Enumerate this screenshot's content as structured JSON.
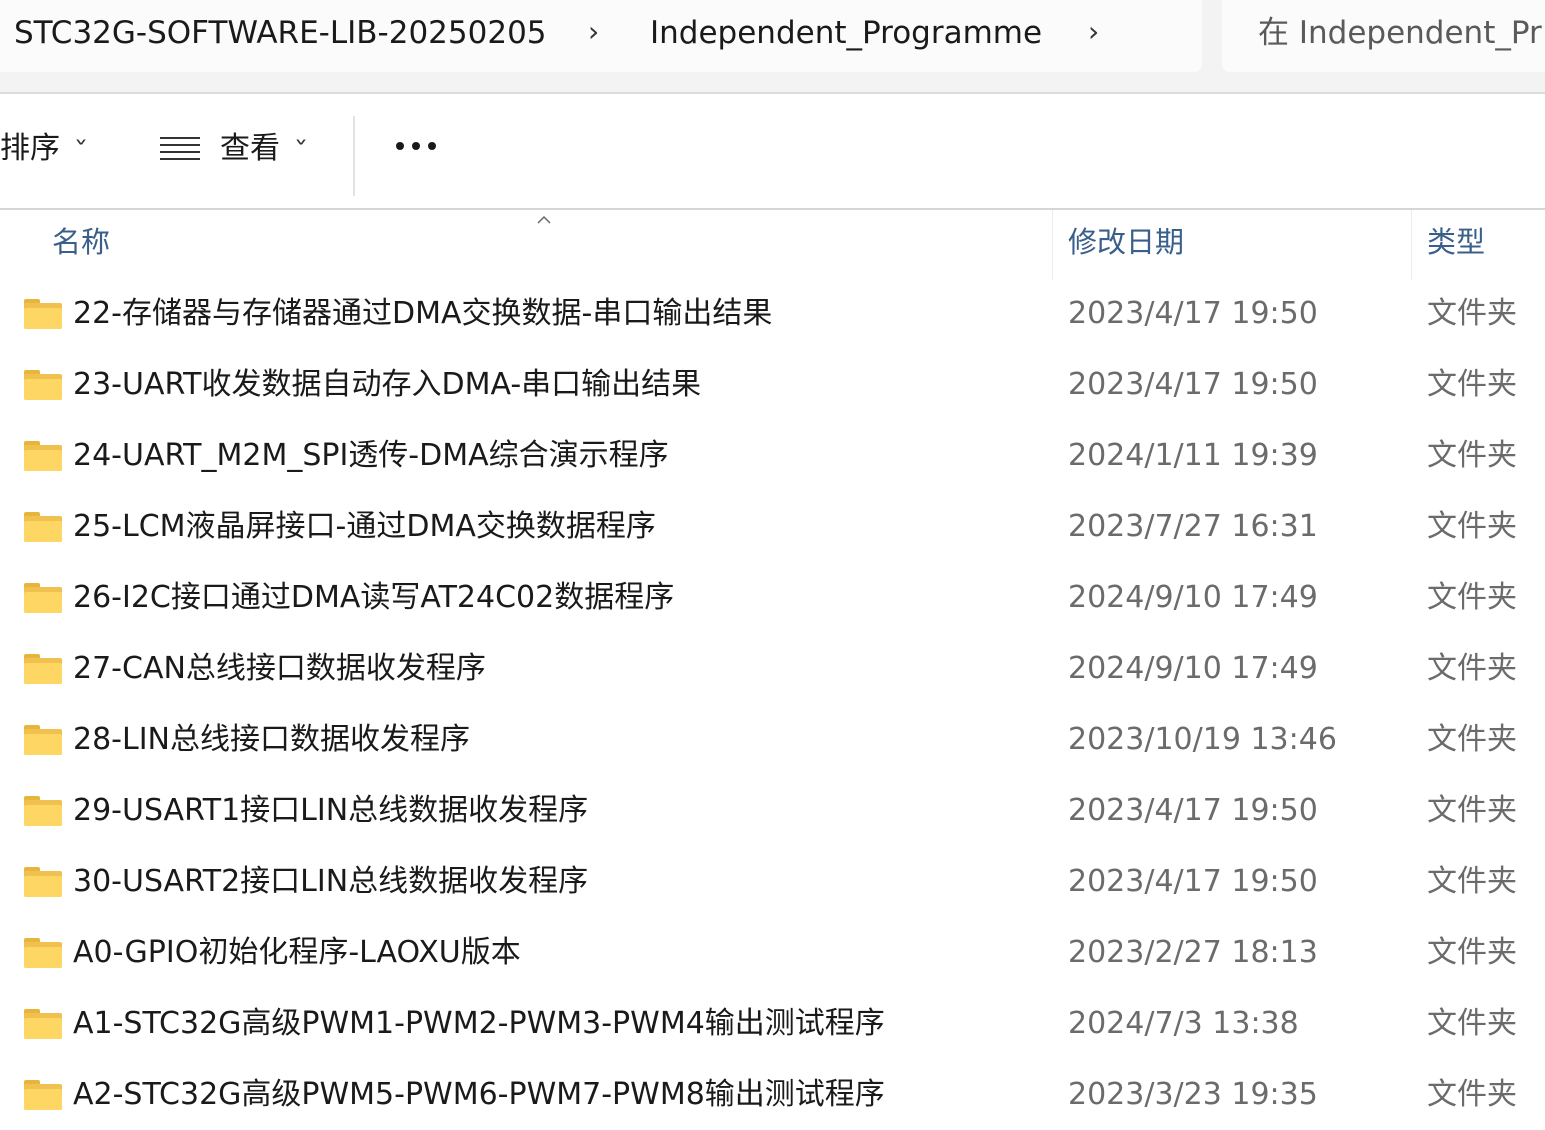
{
  "address_bar": {
    "breadcrumb_root": "STC32G-SOFTWARE-LIB-20250205",
    "breadcrumb_current": "Independent_Programme",
    "search_placeholder": "在 Independent_Pr"
  },
  "toolbar": {
    "sort_label": "排序",
    "view_label": "查看"
  },
  "columns": {
    "name": "名称",
    "date": "修改日期",
    "type": "类型"
  },
  "files": [
    {
      "name": "22-存储器与存储器通过DMA交换数据-串口输出结果",
      "date": "2023/4/17 19:50",
      "type": "文件夹"
    },
    {
      "name": "23-UART收发数据自动存入DMA-串口输出结果",
      "date": "2023/4/17 19:50",
      "type": "文件夹"
    },
    {
      "name": "24-UART_M2M_SPI透传-DMA综合演示程序",
      "date": "2024/1/11 19:39",
      "type": "文件夹"
    },
    {
      "name": "25-LCM液晶屏接口-通过DMA交换数据程序",
      "date": "2023/7/27 16:31",
      "type": "文件夹"
    },
    {
      "name": "26-I2C接口通过DMA读写AT24C02数据程序",
      "date": "2024/9/10 17:49",
      "type": "文件夹"
    },
    {
      "name": "27-CAN总线接口数据收发程序",
      "date": "2024/9/10 17:49",
      "type": "文件夹"
    },
    {
      "name": "28-LIN总线接口数据收发程序",
      "date": "2023/10/19 13:46",
      "type": "文件夹"
    },
    {
      "name": "29-USART1接口LIN总线数据收发程序",
      "date": "2023/4/17 19:50",
      "type": "文件夹"
    },
    {
      "name": "30-USART2接口LIN总线数据收发程序",
      "date": "2023/4/17 19:50",
      "type": "文件夹"
    },
    {
      "name": "A0-GPIO初始化程序-LAOXU版本",
      "date": "2023/2/27 18:13",
      "type": "文件夹"
    },
    {
      "name": "A1-STC32G高级PWM1-PWM2-PWM3-PWM4输出测试程序",
      "date": "2024/7/3 13:38",
      "type": "文件夹"
    },
    {
      "name": "A2-STC32G高级PWM5-PWM6-PWM7-PWM8输出测试程序",
      "date": "2023/3/23 19:35",
      "type": "文件夹"
    }
  ]
}
